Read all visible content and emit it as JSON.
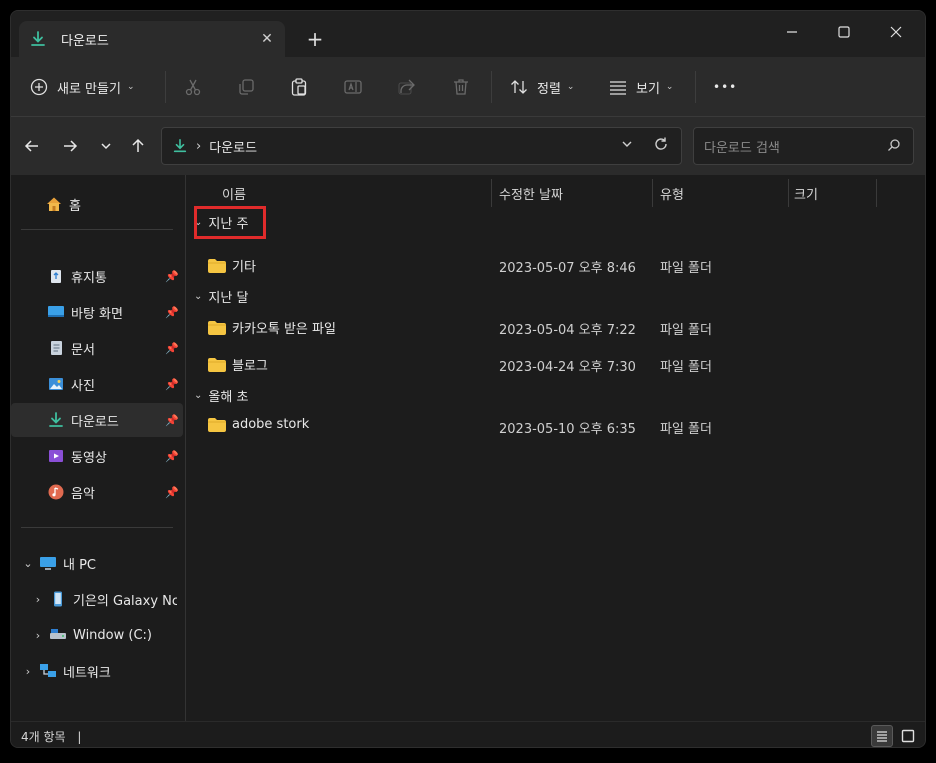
{
  "tab": {
    "title": "다운로드",
    "close_glyph": "✕",
    "new_tab_glyph": "+"
  },
  "window_controls": {
    "minimize": "—",
    "maximize": "☐",
    "close": "✕"
  },
  "toolbar": {
    "new_label": "새로 만들기",
    "sort_label": "정렬",
    "view_label": "보기",
    "more_glyph": "•••",
    "icons": [
      "cut-icon",
      "copy-icon",
      "paste-icon",
      "rename-icon",
      "share-icon",
      "delete-icon"
    ]
  },
  "address": {
    "path_separator": "›",
    "current": "다운로드"
  },
  "search": {
    "placeholder": "다운로드 검색"
  },
  "sidebar": {
    "home": "홈",
    "quick": [
      {
        "label": "휴지통",
        "icon": "recycle-bin-icon"
      },
      {
        "label": "바탕 화면",
        "icon": "desktop-icon"
      },
      {
        "label": "문서",
        "icon": "document-icon"
      },
      {
        "label": "사진",
        "icon": "pictures-icon"
      },
      {
        "label": "다운로드",
        "icon": "download-icon"
      },
      {
        "label": "동영상",
        "icon": "videos-icon"
      },
      {
        "label": "음악",
        "icon": "music-icon"
      }
    ],
    "this_pc": "내 PC",
    "devices": [
      "기은의 Galaxy Nc",
      "Window (C:)"
    ],
    "network": "네트워크"
  },
  "columns": {
    "name": "이름",
    "date": "수정한 날짜",
    "type": "유형",
    "size": "크기"
  },
  "groups": [
    {
      "label": "지난 주",
      "items": [
        {
          "name": "기타",
          "date": "2023-05-07 오후 8:46",
          "type": "파일 폴더"
        }
      ]
    },
    {
      "label": "지난 달",
      "items": [
        {
          "name": "카카오톡 받은 파일",
          "date": "2023-05-04 오후 7:22",
          "type": "파일 폴더"
        },
        {
          "name": "블로그",
          "date": "2023-04-24 오후 7:30",
          "type": "파일 폴더"
        }
      ]
    },
    {
      "label": "올해 초",
      "items": [
        {
          "name": "adobe stork",
          "date": "2023-05-10 오후 6:35",
          "type": "파일 폴더"
        }
      ]
    }
  ],
  "status": {
    "count": "4개 항목",
    "separator": "|"
  },
  "colors": {
    "accent": "#3fbf9f",
    "folder": "#f5c542",
    "highlight": "#e02b2b"
  }
}
